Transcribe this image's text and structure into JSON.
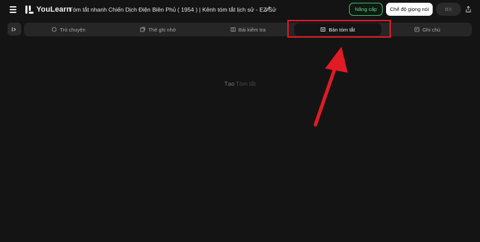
{
  "app": {
    "name": "YouLearn",
    "document_title": "Tóm tắt nhanh Chiến Dịch Điện Biên Phủ ( 1954 ) | Kênh tóm tắt lịch sử - EZ Sử"
  },
  "header": {
    "upgrade_label": "Nâng cấp",
    "voice_mode_label": "Chế độ giọng nói",
    "shortcut_label": "⌘K"
  },
  "tabs": [
    {
      "label": "Trò chuyện",
      "icon": "chat-bubble-icon"
    },
    {
      "label": "Thẻ ghi nhớ",
      "icon": "flashcards-icon"
    },
    {
      "label": "Bài kiểm tra",
      "icon": "quiz-book-icon"
    },
    {
      "label": "Bản tóm tắt",
      "icon": "summary-icon",
      "active": true
    },
    {
      "label": "Ghi chú",
      "icon": "notes-icon"
    }
  ],
  "main": {
    "generate_prefix": "Tạo",
    "generate_target": "Tóm tắt"
  },
  "colors": {
    "background": "#141414",
    "tabbar": "#262626",
    "accent_green": "#3fbf6a",
    "annotation_red": "#e01b24"
  }
}
